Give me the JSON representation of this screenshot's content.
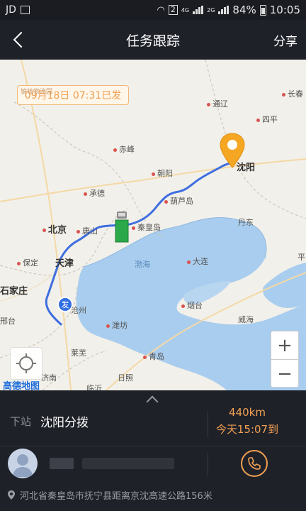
{
  "status_bar": {
    "carrier": "JD",
    "network_1": "4G",
    "network_2": "2G",
    "sim": "2",
    "battery": "84%",
    "time": "10:05"
  },
  "nav": {
    "title": "任务跟踪",
    "share_label": "分享"
  },
  "map": {
    "departure_badge": "09月18日 07:31已发",
    "badge_faint": "锦桂物流园",
    "start_marker": "发",
    "logo": "高德地图",
    "labels": {
      "shenyang": "沈阳",
      "changchun": "长春",
      "siping": "四平",
      "tongliao": "通辽",
      "chifeng": "赤峰",
      "chaoyang": "朝阳",
      "chengde": "承德",
      "huludao": "葫芦岛",
      "qinhuangdao": "秦皇岛",
      "tangshan": "唐山",
      "beijing": "北京",
      "tianjin": "天津",
      "baoding": "保定",
      "shijiazhuang": "石家庄",
      "handan": "邢台",
      "cangzhou": "沧州",
      "dandong": "丹东",
      "dalian": "大连",
      "yantai": "烟台",
      "weifang": "潍坊",
      "qingdao": "青岛",
      "laiwu": "莱芜",
      "rizhao": "日照",
      "linyi": "临沂",
      "jinan": "济南",
      "weihai": "威海",
      "pingrang": "平",
      "bohai": "渤海"
    },
    "zoom_in": "+",
    "zoom_out": "−"
  },
  "panel": {
    "next_stop_label": "下站",
    "next_stop": "沈阳分拨",
    "distance": "440km",
    "eta": "今天15:07到",
    "address": "河北省秦皇岛市抚宁县距离京沈高速公路156米"
  },
  "colors": {
    "accent": "#f0a052",
    "route": "#3f6fe0",
    "panel_bg": "#1f2129",
    "sea": "#a9cdee",
    "land": "#f2f0ea"
  }
}
